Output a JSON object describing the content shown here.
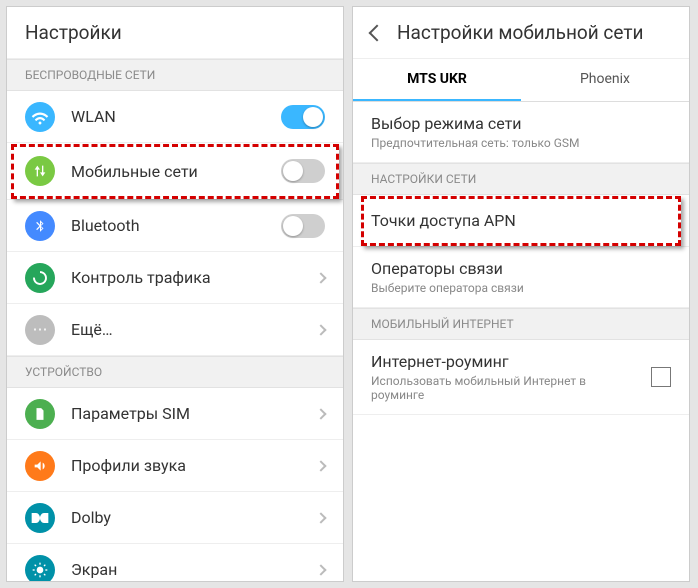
{
  "left": {
    "title": "Настройки",
    "section_wireless": "БЕСПРОВОДНЫЕ СЕТИ",
    "section_device": "УСТРОЙСТВО",
    "items": {
      "wlan": "WLAN",
      "mobile": "Мобильные сети",
      "bluetooth": "Bluetooth",
      "traffic": "Контроль трафика",
      "more": "Ещё…",
      "sim": "Параметры SIM",
      "sound": "Профили звука",
      "dolby": "Dolby",
      "screen": "Экран"
    }
  },
  "right": {
    "title": "Настройки мобильной сети",
    "tabs": {
      "mts": "MTS UKR",
      "phoenix": "Phoenix"
    },
    "network_mode_title": "Выбор режима сети",
    "network_mode_sub": "Предпочтительная сеть: только GSM",
    "section_net": "НАСТРОЙКИ СЕТИ",
    "apn": "Точки доступа APN",
    "operators_title": "Операторы связи",
    "operators_sub": "Выберите оператора связи",
    "section_mobile_internet": "МОБИЛЬНЫЙ ИНТЕРНЕТ",
    "roaming_title": "Интернет-роуминг",
    "roaming_sub": "Использовать мобильный Интернет в роуминге"
  }
}
